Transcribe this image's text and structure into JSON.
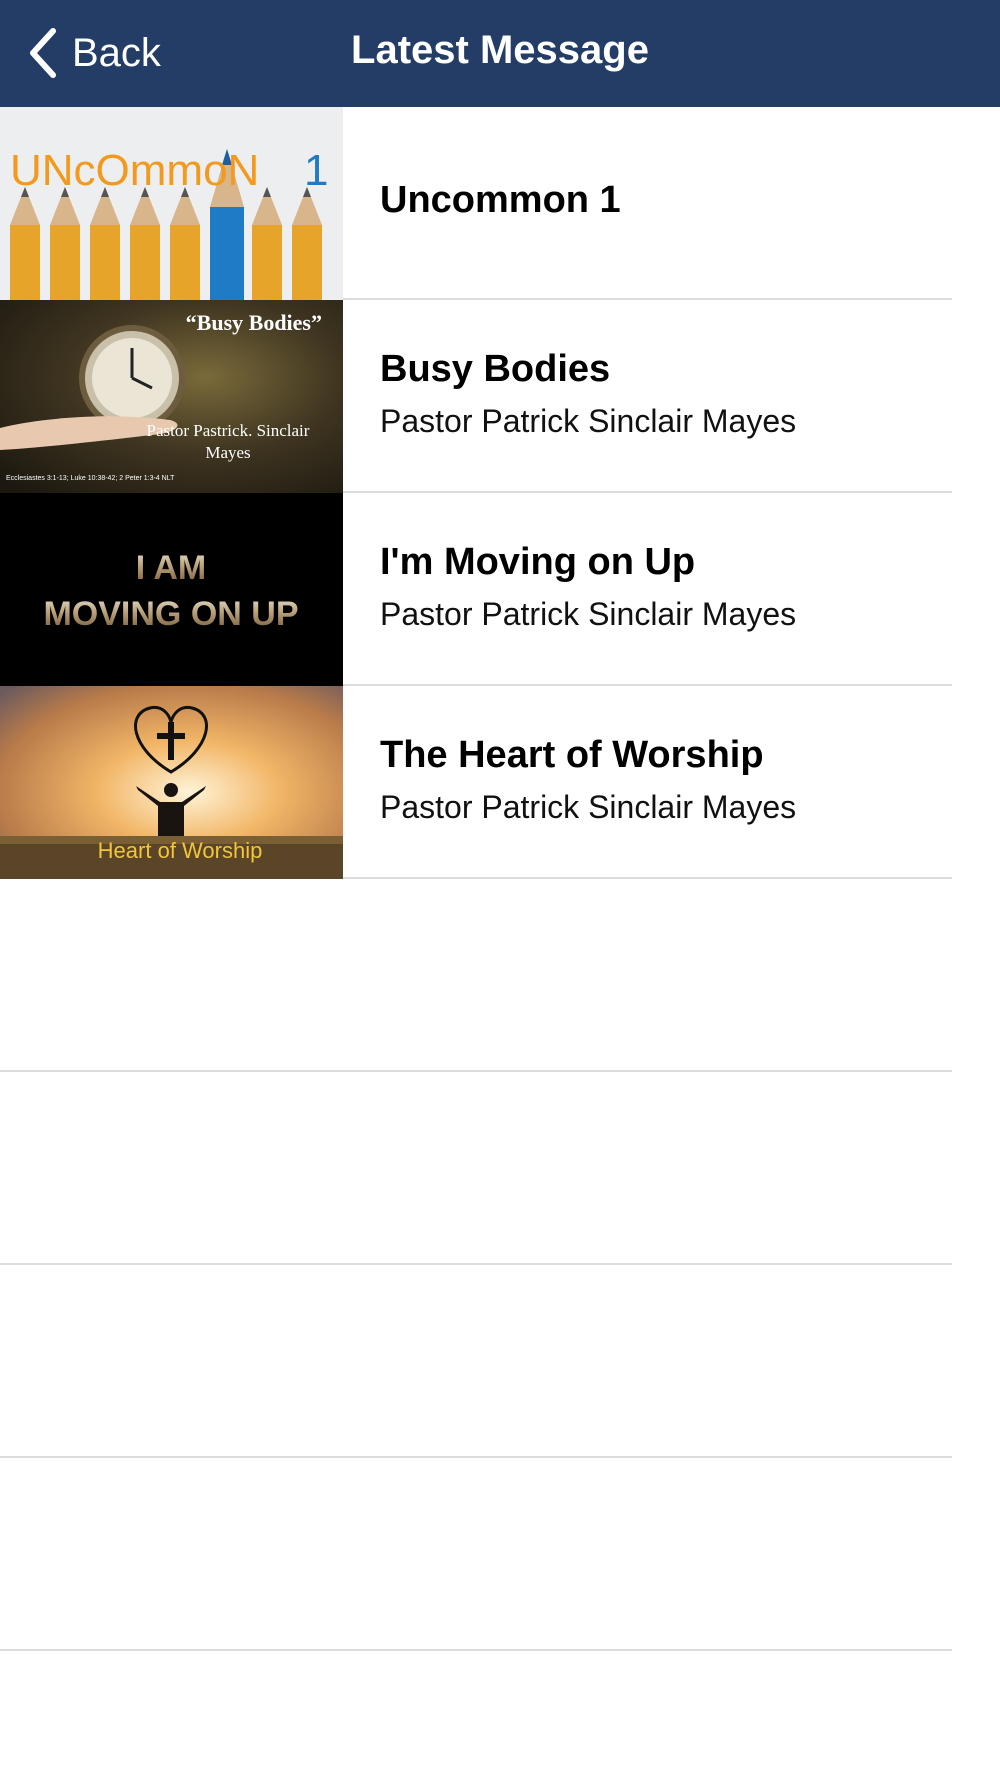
{
  "navbar": {
    "back_label": "Back",
    "title": "Latest Message",
    "background_color": "#233d66"
  },
  "messages": [
    {
      "title": "Uncommon 1",
      "speaker": "",
      "thumbnail": {
        "icon": "pencils-image",
        "text": "UNcOmmoN",
        "number": "1"
      }
    },
    {
      "title": "Busy Bodies",
      "speaker": "Pastor Patrick Sinclair Mayes",
      "thumbnail": {
        "icon": "clock-in-hand-image",
        "heading": "“Busy Bodies”",
        "byline_1": "Pastor Pastrick. Sinclair",
        "byline_2": "Mayes",
        "scripture": "Ecclesiastes 3:1-13; Luke 10:38-42; 2 Peter 1:3-4 NLT"
      }
    },
    {
      "title": "I'm Moving on Up",
      "speaker": "Pastor Patrick Sinclair Mayes",
      "thumbnail": {
        "icon": "moving-on-up-text-image",
        "line_1": "I AM",
        "line_2": "MOVING ON UP"
      }
    },
    {
      "title": "The Heart of Worship",
      "speaker": "Pastor Patrick Sinclair Mayes",
      "thumbnail": {
        "icon": "heart-cross-worshipper-image",
        "caption": "Heart of Worship"
      }
    }
  ],
  "empty_rows": 4
}
